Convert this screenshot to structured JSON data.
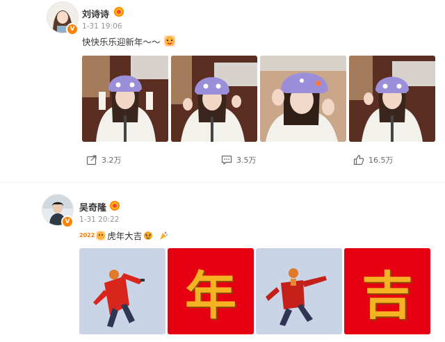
{
  "posts": [
    {
      "username": "刘诗诗",
      "time": "1-31 19:06",
      "text": "快快乐乐迎新年～～",
      "actions": {
        "repost": "3.2万",
        "comment": "3.5万",
        "like": "16.5万"
      },
      "images": [
        "photo-1",
        "photo-2",
        "photo-3",
        "photo-4"
      ]
    },
    {
      "username": "吴奇隆",
      "time": "1-31 20:22",
      "text_prefix": "2022",
      "text": "虎年大吉",
      "images": [
        "photo-red-coat-1",
        "tile-nian",
        "photo-red-coat-2",
        "tile-ji"
      ],
      "tiles": {
        "nian": "年",
        "ji": "吉"
      }
    }
  ],
  "colors": {
    "verified": "#ff8200",
    "tile_red": "#e60012",
    "tile_char": "#f5b324",
    "sky": "#c9d4e6"
  }
}
